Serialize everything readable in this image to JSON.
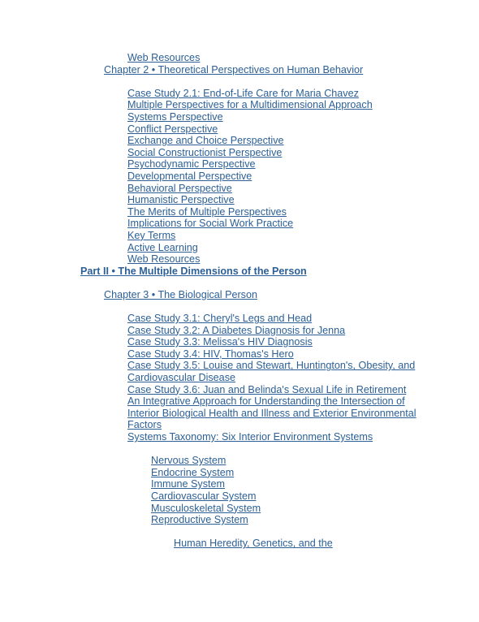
{
  "document": {
    "type": "table-of-contents",
    "link_color": "#2c6096",
    "background_color": "#ffffff",
    "entries": [
      {
        "text": "Web Resources",
        "level": "item",
        "bold": false
      },
      {
        "text": "Chapter 2 • Theoretical Perspectives on Human Behavior",
        "level": "chap",
        "bold": false
      },
      {
        "text": "",
        "level": "spacer",
        "bold": false
      },
      {
        "text": "Case Study 2.1: End-of-Life Care for Maria Chavez",
        "level": "item",
        "bold": false
      },
      {
        "text": "Multiple Perspectives for a Multidimensional Approach",
        "level": "item",
        "bold": false
      },
      {
        "text": "Systems Perspective",
        "level": "item",
        "bold": false
      },
      {
        "text": "Conflict Perspective",
        "level": "item",
        "bold": false
      },
      {
        "text": "Exchange and Choice Perspective",
        "level": "item",
        "bold": false
      },
      {
        "text": "Social Constructionist Perspective",
        "level": "item",
        "bold": false
      },
      {
        "text": "Psychodynamic Perspective",
        "level": "item",
        "bold": false
      },
      {
        "text": "Developmental Perspective",
        "level": "item",
        "bold": false
      },
      {
        "text": "Behavioral Perspective",
        "level": "item",
        "bold": false
      },
      {
        "text": "Humanistic Perspective",
        "level": "item",
        "bold": false
      },
      {
        "text": "The Merits of Multiple Perspectives",
        "level": "item",
        "bold": false
      },
      {
        "text": "Implications for Social Work Practice",
        "level": "item",
        "bold": false
      },
      {
        "text": "Key Terms",
        "level": "item",
        "bold": false
      },
      {
        "text": "Active Learning",
        "level": "item",
        "bold": false
      },
      {
        "text": "Web Resources",
        "level": "item",
        "bold": false
      },
      {
        "text": "Part II • The Multiple Dimensions of the Person",
        "level": "part",
        "bold": true
      },
      {
        "text": "",
        "level": "spacer",
        "bold": false
      },
      {
        "text": "Chapter 3 • The Biological Person",
        "level": "chap",
        "bold": false
      },
      {
        "text": "",
        "level": "spacer",
        "bold": false
      },
      {
        "text": "Case Study 3.1: Cheryl's Legs and Head",
        "level": "item",
        "bold": false
      },
      {
        "text": "Case Study 3.2: A Diabetes Diagnosis for Jenna",
        "level": "item",
        "bold": false
      },
      {
        "text": "Case Study 3.3: Melissa's HIV Diagnosis",
        "level": "item",
        "bold": false
      },
      {
        "text": "Case Study 3.4: HIV, Thomas's Hero",
        "level": "item",
        "bold": false
      },
      {
        "text": "Case Study 3.5: Louise and Stewart, Huntington's, Obesity, and Cardiovascular Disease",
        "level": "item",
        "bold": false
      },
      {
        "text": "Case Study 3.6: Juan and Belinda's Sexual Life in Retirement",
        "level": "item",
        "bold": false
      },
      {
        "text": "An Integrative Approach for Understanding the Intersection of Interior Biological Health and Illness and Exterior Environmental Factors",
        "level": "item",
        "bold": false
      },
      {
        "text": "Systems Taxonomy: Six Interior Environment Systems",
        "level": "item",
        "bold": false
      },
      {
        "text": "",
        "level": "spacer",
        "bold": false
      },
      {
        "text": "Nervous System",
        "level": "sub",
        "bold": false
      },
      {
        "text": "Endocrine System",
        "level": "sub",
        "bold": false
      },
      {
        "text": "Immune System",
        "level": "sub",
        "bold": false
      },
      {
        "text": "Cardiovascular System",
        "level": "sub",
        "bold": false
      },
      {
        "text": "Musculoskeletal System",
        "level": "sub",
        "bold": false
      },
      {
        "text": "Reproductive System",
        "level": "sub",
        "bold": false
      },
      {
        "text": "",
        "level": "spacer",
        "bold": false
      },
      {
        "text": "Human Heredity, Genetics, and the",
        "level": "subsub",
        "bold": false
      }
    ]
  }
}
